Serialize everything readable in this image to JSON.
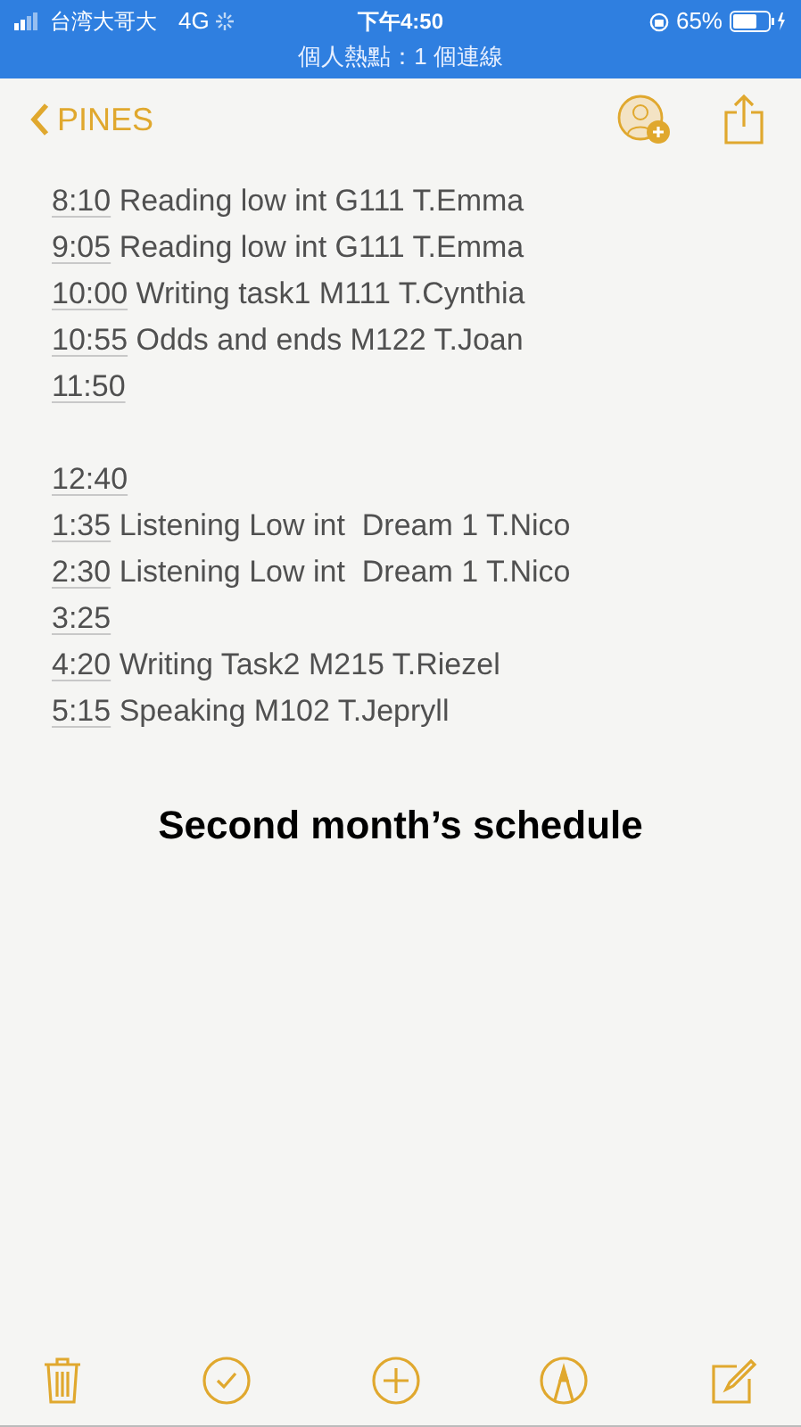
{
  "status_bar": {
    "carrier": "台湾大哥大",
    "network": "4G",
    "time": "下午4:50",
    "battery": "65%",
    "hotspot": "個人熱點：1 個連線"
  },
  "nav": {
    "back": "PINES"
  },
  "note": {
    "blocks": [
      [
        {
          "time": "8:10",
          "text": "Reading low int G111 T.Emma"
        },
        {
          "time": "9:05",
          "text": "Reading low int G111 T.Emma"
        },
        {
          "time": "10:00",
          "text": "Writing task1 M111 T.Cynthia"
        },
        {
          "time": "10:55",
          "text": "Odds and ends M122 T.Joan"
        },
        {
          "time": "11:50"
        }
      ],
      [
        {
          "time": "12:40"
        },
        {
          "time": "1:35",
          "text": "Listening Low int  Dream 1 T.Nico"
        },
        {
          "time": "2:30",
          "text": "Listening Low int  Dream 1 T.Nico"
        },
        {
          "time": "3:25"
        },
        {
          "time": "4:20",
          "text": "Writing Task2 M215 T.Riezel"
        },
        {
          "time": "5:15",
          "text": "Speaking M102 T.Jepryll"
        }
      ]
    ],
    "heading": "Second month’s schedule"
  }
}
